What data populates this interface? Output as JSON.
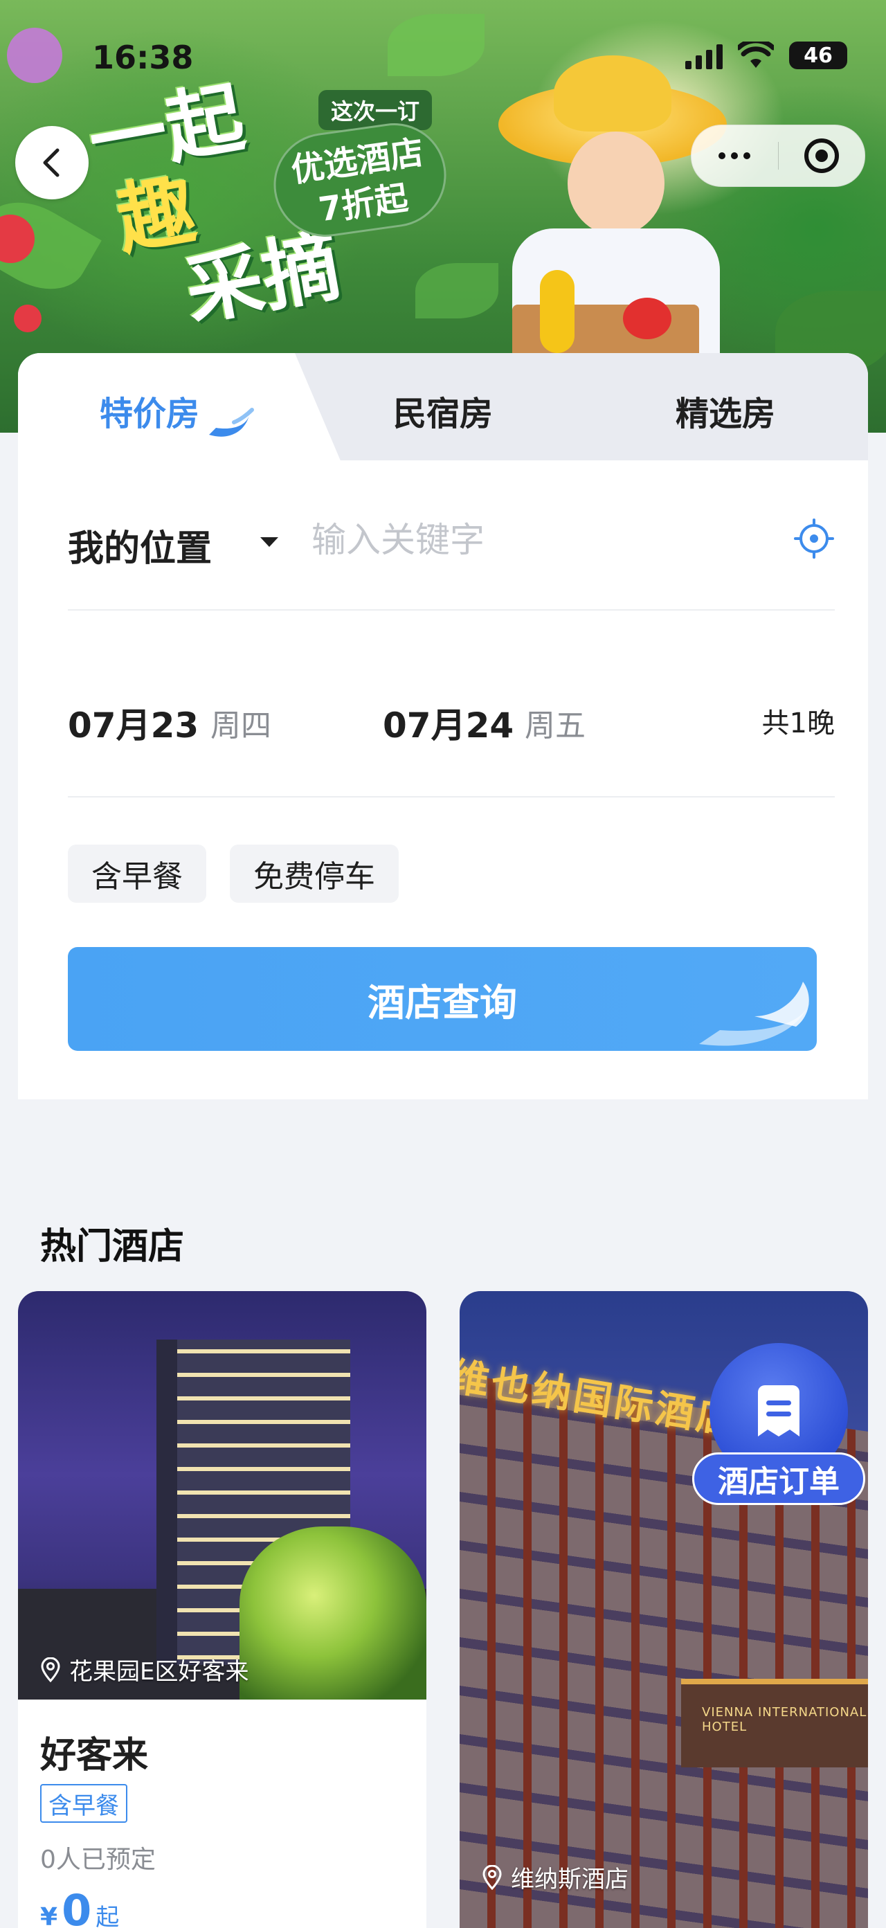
{
  "status_bar": {
    "time": "16:38",
    "battery": "46"
  },
  "banner": {
    "title_lines": [
      "一起",
      "趣",
      "采摘"
    ],
    "tag": "这次一订",
    "promo_line1": "优选酒店",
    "promo_line2": "7折起"
  },
  "tabs": [
    {
      "label": "特价房",
      "active": true
    },
    {
      "label": "民宿房",
      "active": false
    },
    {
      "label": "精选房",
      "active": false
    }
  ],
  "search": {
    "location_label": "我的位置",
    "keyword_placeholder": "输入关键字",
    "keyword_value": "",
    "checkin_date": "07月23",
    "checkin_day": "周四",
    "checkout_date": "07月24",
    "checkout_day": "周五",
    "nights": "共1晚",
    "filters": [
      "含早餐",
      "免费停车"
    ],
    "button_label": "酒店查询"
  },
  "hot_hotels": {
    "title": "热门酒店",
    "items": [
      {
        "location": "花果园E区好客来",
        "name": "好客来",
        "tag": "含早餐",
        "booked": "0人已预定",
        "price_currency": "¥",
        "price": "0",
        "price_suffix": "起"
      },
      {
        "location": "维纳斯酒店",
        "sign_text": "维也纳国际酒店",
        "canopy_text": "VIENNA INTERNATIONAL HOTEL"
      }
    ]
  },
  "floating": {
    "order_label": "酒店订单"
  },
  "colors": {
    "accent": "#3c8bec",
    "button": "#4aa3f4",
    "fab": "#3e62e4"
  }
}
